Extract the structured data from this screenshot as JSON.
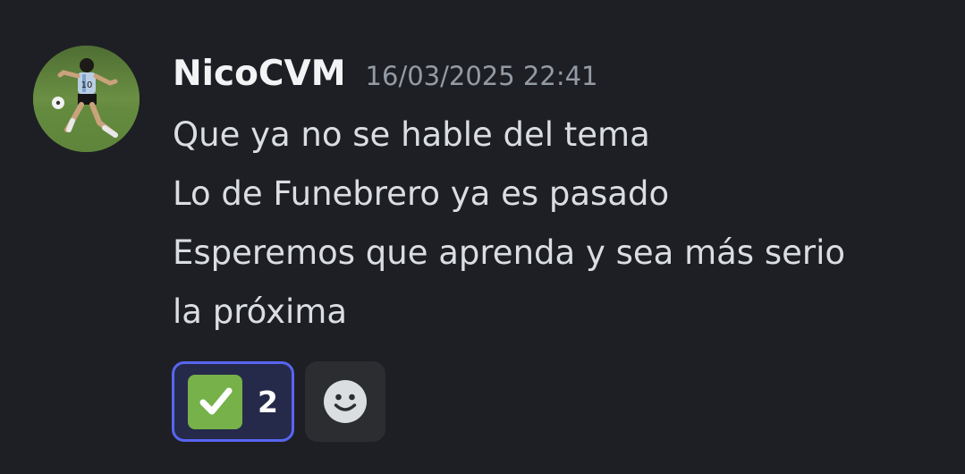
{
  "message": {
    "username": "NicoCVM",
    "timestamp": "16/03/2025 22:41",
    "avatar_icon": "footballer-avatar",
    "lines": [
      "Que ya no se hable del tema",
      "Lo de Funebrero ya es pasado",
      "Esperemos que aprenda y sea más serio",
      "la próxima"
    ],
    "reactions": [
      {
        "emoji": "white-check-mark",
        "count": "2",
        "selected": true
      }
    ],
    "add_reaction_icon": "smiley-add-reaction-icon"
  },
  "colors": {
    "background": "#1e1f24",
    "username": "#f2f3f5",
    "timestamp": "#949ba4",
    "text": "#dbdee1",
    "reaction_selected_bg": "#262a4a",
    "reaction_selected_border": "#5865f2",
    "check_green": "#76b14a",
    "add_reaction_bg": "#2b2d31"
  }
}
